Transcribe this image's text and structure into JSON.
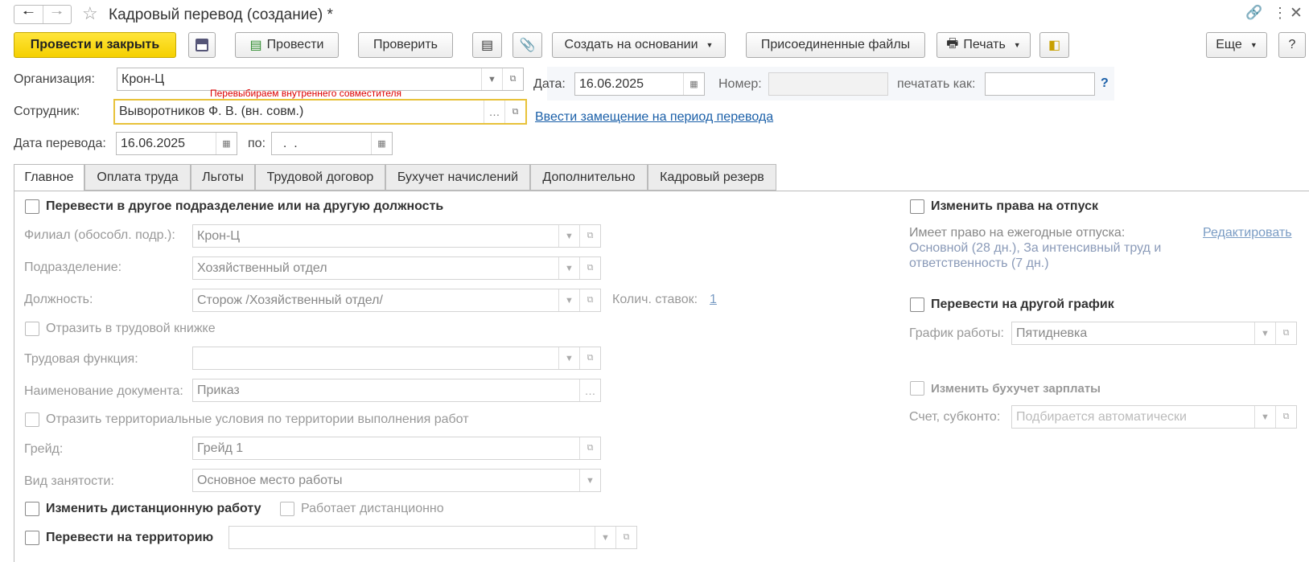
{
  "window": {
    "title": "Кадровый перевод (создание) *"
  },
  "toolbar": {
    "post_close": "Провести и закрыть",
    "post": "Провести",
    "check": "Проверить",
    "create_based": "Создать на основании",
    "attached": "Присоединенные файлы",
    "print": "Печать",
    "more": "Еще",
    "help": "?"
  },
  "header": {
    "org_label": "Организация:",
    "org_value": "Крон-Ц",
    "date_label": "Дата:",
    "date_value": "16.06.2025",
    "number_label": "Номер:",
    "number_value": "",
    "print_as_label": "печатать как:",
    "print_as_value": "",
    "help_mark": "?",
    "employee_label": "Сотрудник:",
    "employee_value": "Выворотников Ф. В. (вн. совм.)",
    "employee_hint": "Перевыбираем внутреннего совместителя",
    "substitution_link": "Ввести замещение на период перевода",
    "transfer_date_label": "Дата перевода:",
    "transfer_date_value": "16.06.2025",
    "to_label": "по:",
    "to_value": "  .  ."
  },
  "tabs": [
    "Главное",
    "Оплата труда",
    "Льготы",
    "Трудовой договор",
    "Бухучет начислений",
    "Дополнительно",
    "Кадровый резерв"
  ],
  "main": {
    "transfer_check": "Перевести в другое подразделение или на другую должность",
    "branch_label": "Филиал (обособл. подр.):",
    "branch_value": "Крон-Ц",
    "dept_label": "Подразделение:",
    "dept_value": "Хозяйственный отдел",
    "position_label": "Должность:",
    "position_value": "Сторож /Хозяйственный отдел/",
    "rates_label": "Колич. ставок:",
    "rates_value": "1",
    "labor_book": "Отразить в трудовой книжке",
    "labor_func_label": "Трудовая функция:",
    "labor_func_value": "",
    "doc_name_label": "Наименование документа:",
    "doc_name_value": "Приказ",
    "territorial": "Отразить территориальные условия по территории выполнения работ",
    "grade_label": "Грейд:",
    "grade_value": "Грейд 1",
    "employment_label": "Вид занятости:",
    "employment_value": "Основное место работы",
    "remote_check": "Изменить дистанционную работу",
    "remote_works": "Работает дистанционно",
    "territory_check": "Перевести на территорию",
    "territory_value": ""
  },
  "right": {
    "vacation_check": "Изменить права на отпуск",
    "vacation_info": "Имеет право на ежегодные отпуска:",
    "edit_link": "Редактировать",
    "vacation_line1": "Основной (28 дн.), За интенсивный труд и",
    "vacation_line2": "ответственность (7 дн.)",
    "schedule_check": "Перевести на другой график",
    "schedule_label": "График работы:",
    "schedule_value": "Пятидневка",
    "accounting_check": "Изменить бухучет зарплаты",
    "account_label": "Счет, субконто:",
    "account_placeholder": "Подбирается автоматически"
  }
}
